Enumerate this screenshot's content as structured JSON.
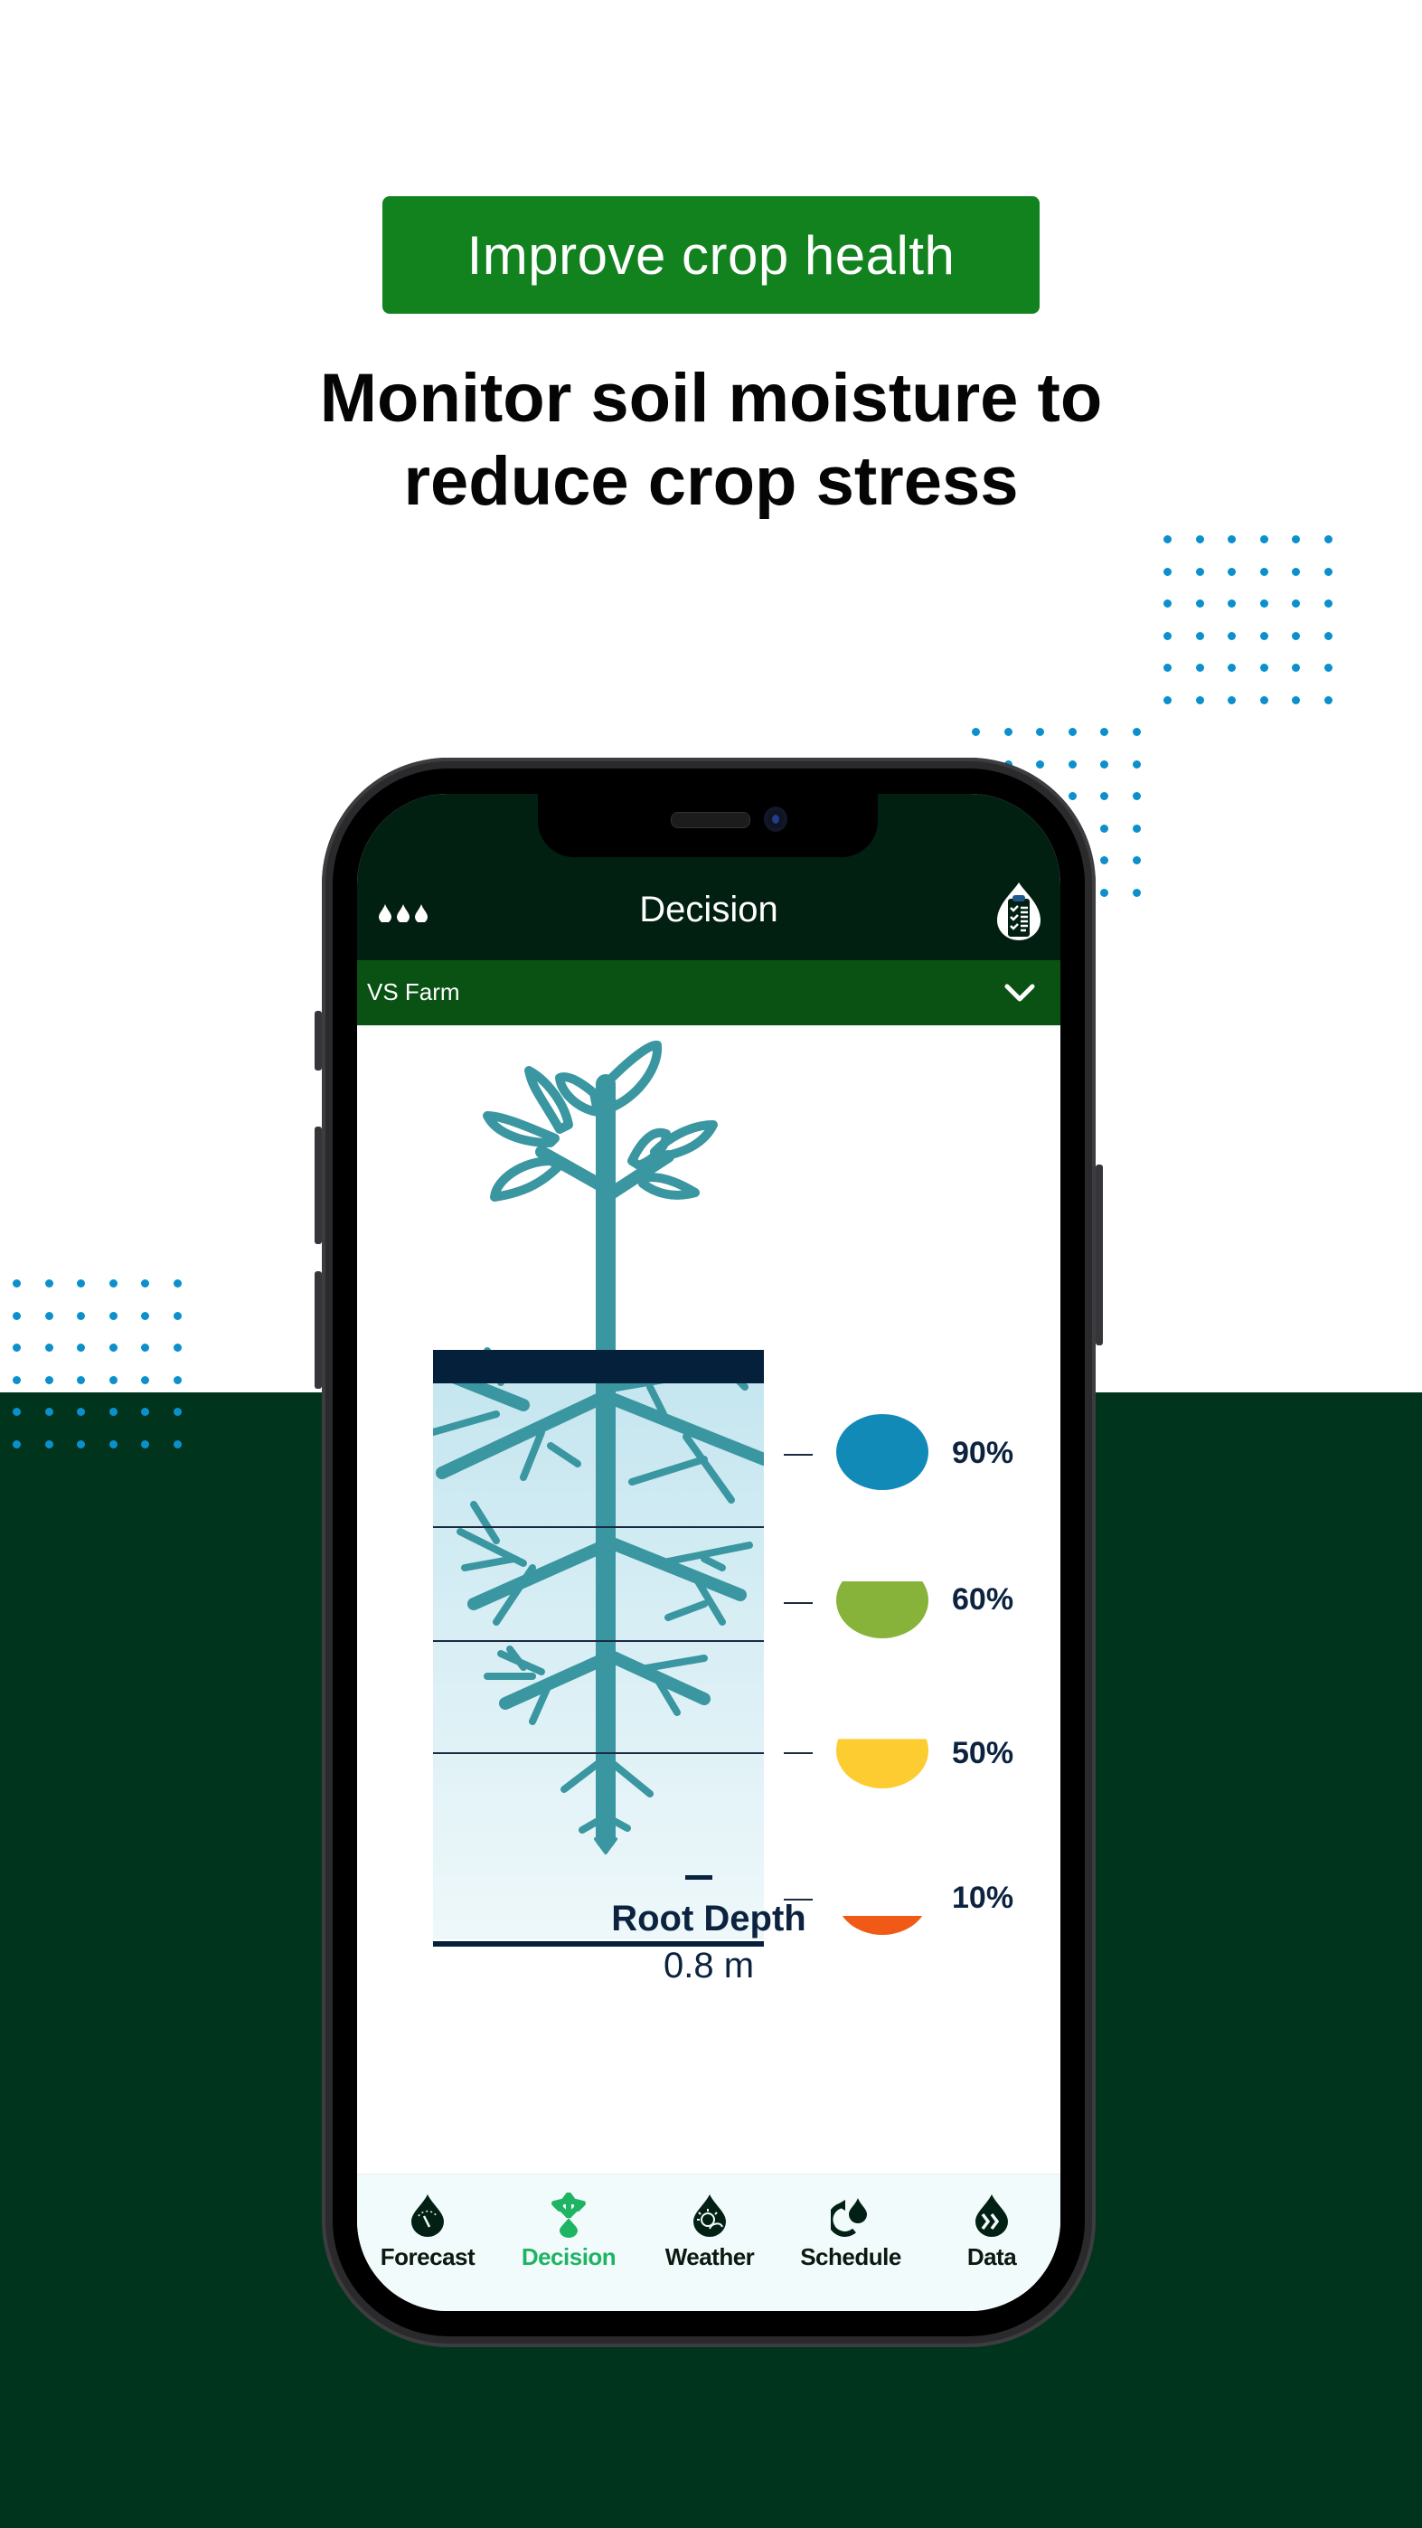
{
  "promo": {
    "badge_label": "Improve crop health",
    "headline_line1": "Monitor soil moisture to",
    "headline_line2": "reduce crop stress"
  },
  "colors": {
    "badge_green": "#12821f",
    "background_dark_green": "#00341d",
    "dot_blue": "#0b90cc",
    "header_dark": "#012012",
    "farm_bar_green": "#0a5214",
    "plant_teal": "#3a96a0",
    "text_navy": "#0c2340",
    "active_tab_green": "#1eb464"
  },
  "app": {
    "header": {
      "title": "Decision",
      "left_icon": "water-drops-icon",
      "right_icon": "clipboard-drop-icon"
    },
    "farm_selector": {
      "selected": "VS Farm",
      "icon": "chevron-down-icon"
    },
    "soil_moisture": {
      "layers": [
        {
          "label": "90%",
          "value": 90,
          "color": "#118ab8"
        },
        {
          "label": "60%",
          "value": 60,
          "color": "#88b33a"
        },
        {
          "label": "50%",
          "value": 50,
          "color": "#fdcc30"
        },
        {
          "label": "10%",
          "value": 10,
          "color": "#f05a16"
        }
      ]
    },
    "root_depth": {
      "label": "Root Depth",
      "value": "0.8 m"
    },
    "tabs": [
      {
        "label": "Forecast",
        "icon": "forecast-drop-gauge-icon",
        "active": false
      },
      {
        "label": "Decision",
        "icon": "decision-arrows-icon",
        "active": true
      },
      {
        "label": "Weather",
        "icon": "weather-drop-icon",
        "active": false
      },
      {
        "label": "Schedule",
        "icon": "schedule-cycle-icon",
        "active": false
      },
      {
        "label": "Data",
        "icon": "data-drop-chevrons-icon",
        "active": false
      }
    ]
  }
}
